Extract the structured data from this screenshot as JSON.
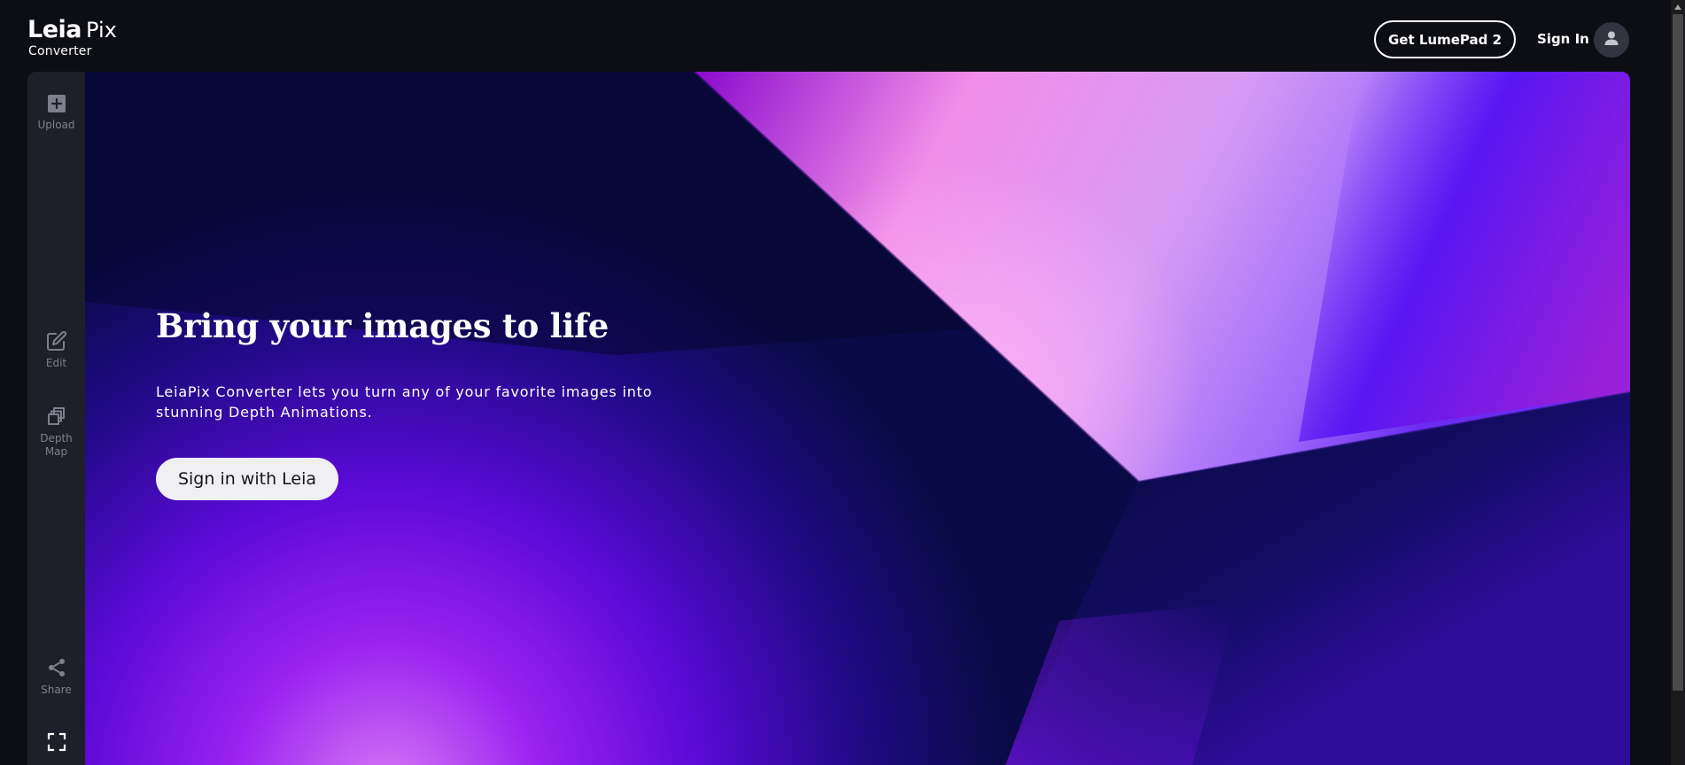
{
  "header": {
    "logo": {
      "brand": "Leia",
      "product": "Pix",
      "subtitle": "Converter"
    },
    "get_lumepad_label": "Get LumePad 2",
    "sign_in_label": "Sign In",
    "avatar_icon": "user-icon"
  },
  "sidebar": {
    "items": [
      {
        "label": "Upload",
        "icon": "plus-square-icon"
      },
      {
        "label": "Edit",
        "icon": "edit-icon"
      },
      {
        "label": "Depth Map",
        "icon": "layers-icon"
      },
      {
        "label": "Share",
        "icon": "share-icon"
      },
      {
        "label": "",
        "icon": "fullscreen-icon"
      }
    ]
  },
  "hero": {
    "title": "Bring your images to life",
    "description": "LeiaPix Converter lets you turn any of your favorite images into stunning Depth Animations.",
    "cta_label": "Sign in with Leia"
  },
  "colors": {
    "background": "#0d0e14",
    "sidebar": "#1e1f28",
    "sidebar_text": "#7d7f8c",
    "hero_deep": "#0b0a3e",
    "hero_purple": "#7a10f0",
    "hero_pink": "#f59aef",
    "cta_background": "#f0f0f3"
  }
}
